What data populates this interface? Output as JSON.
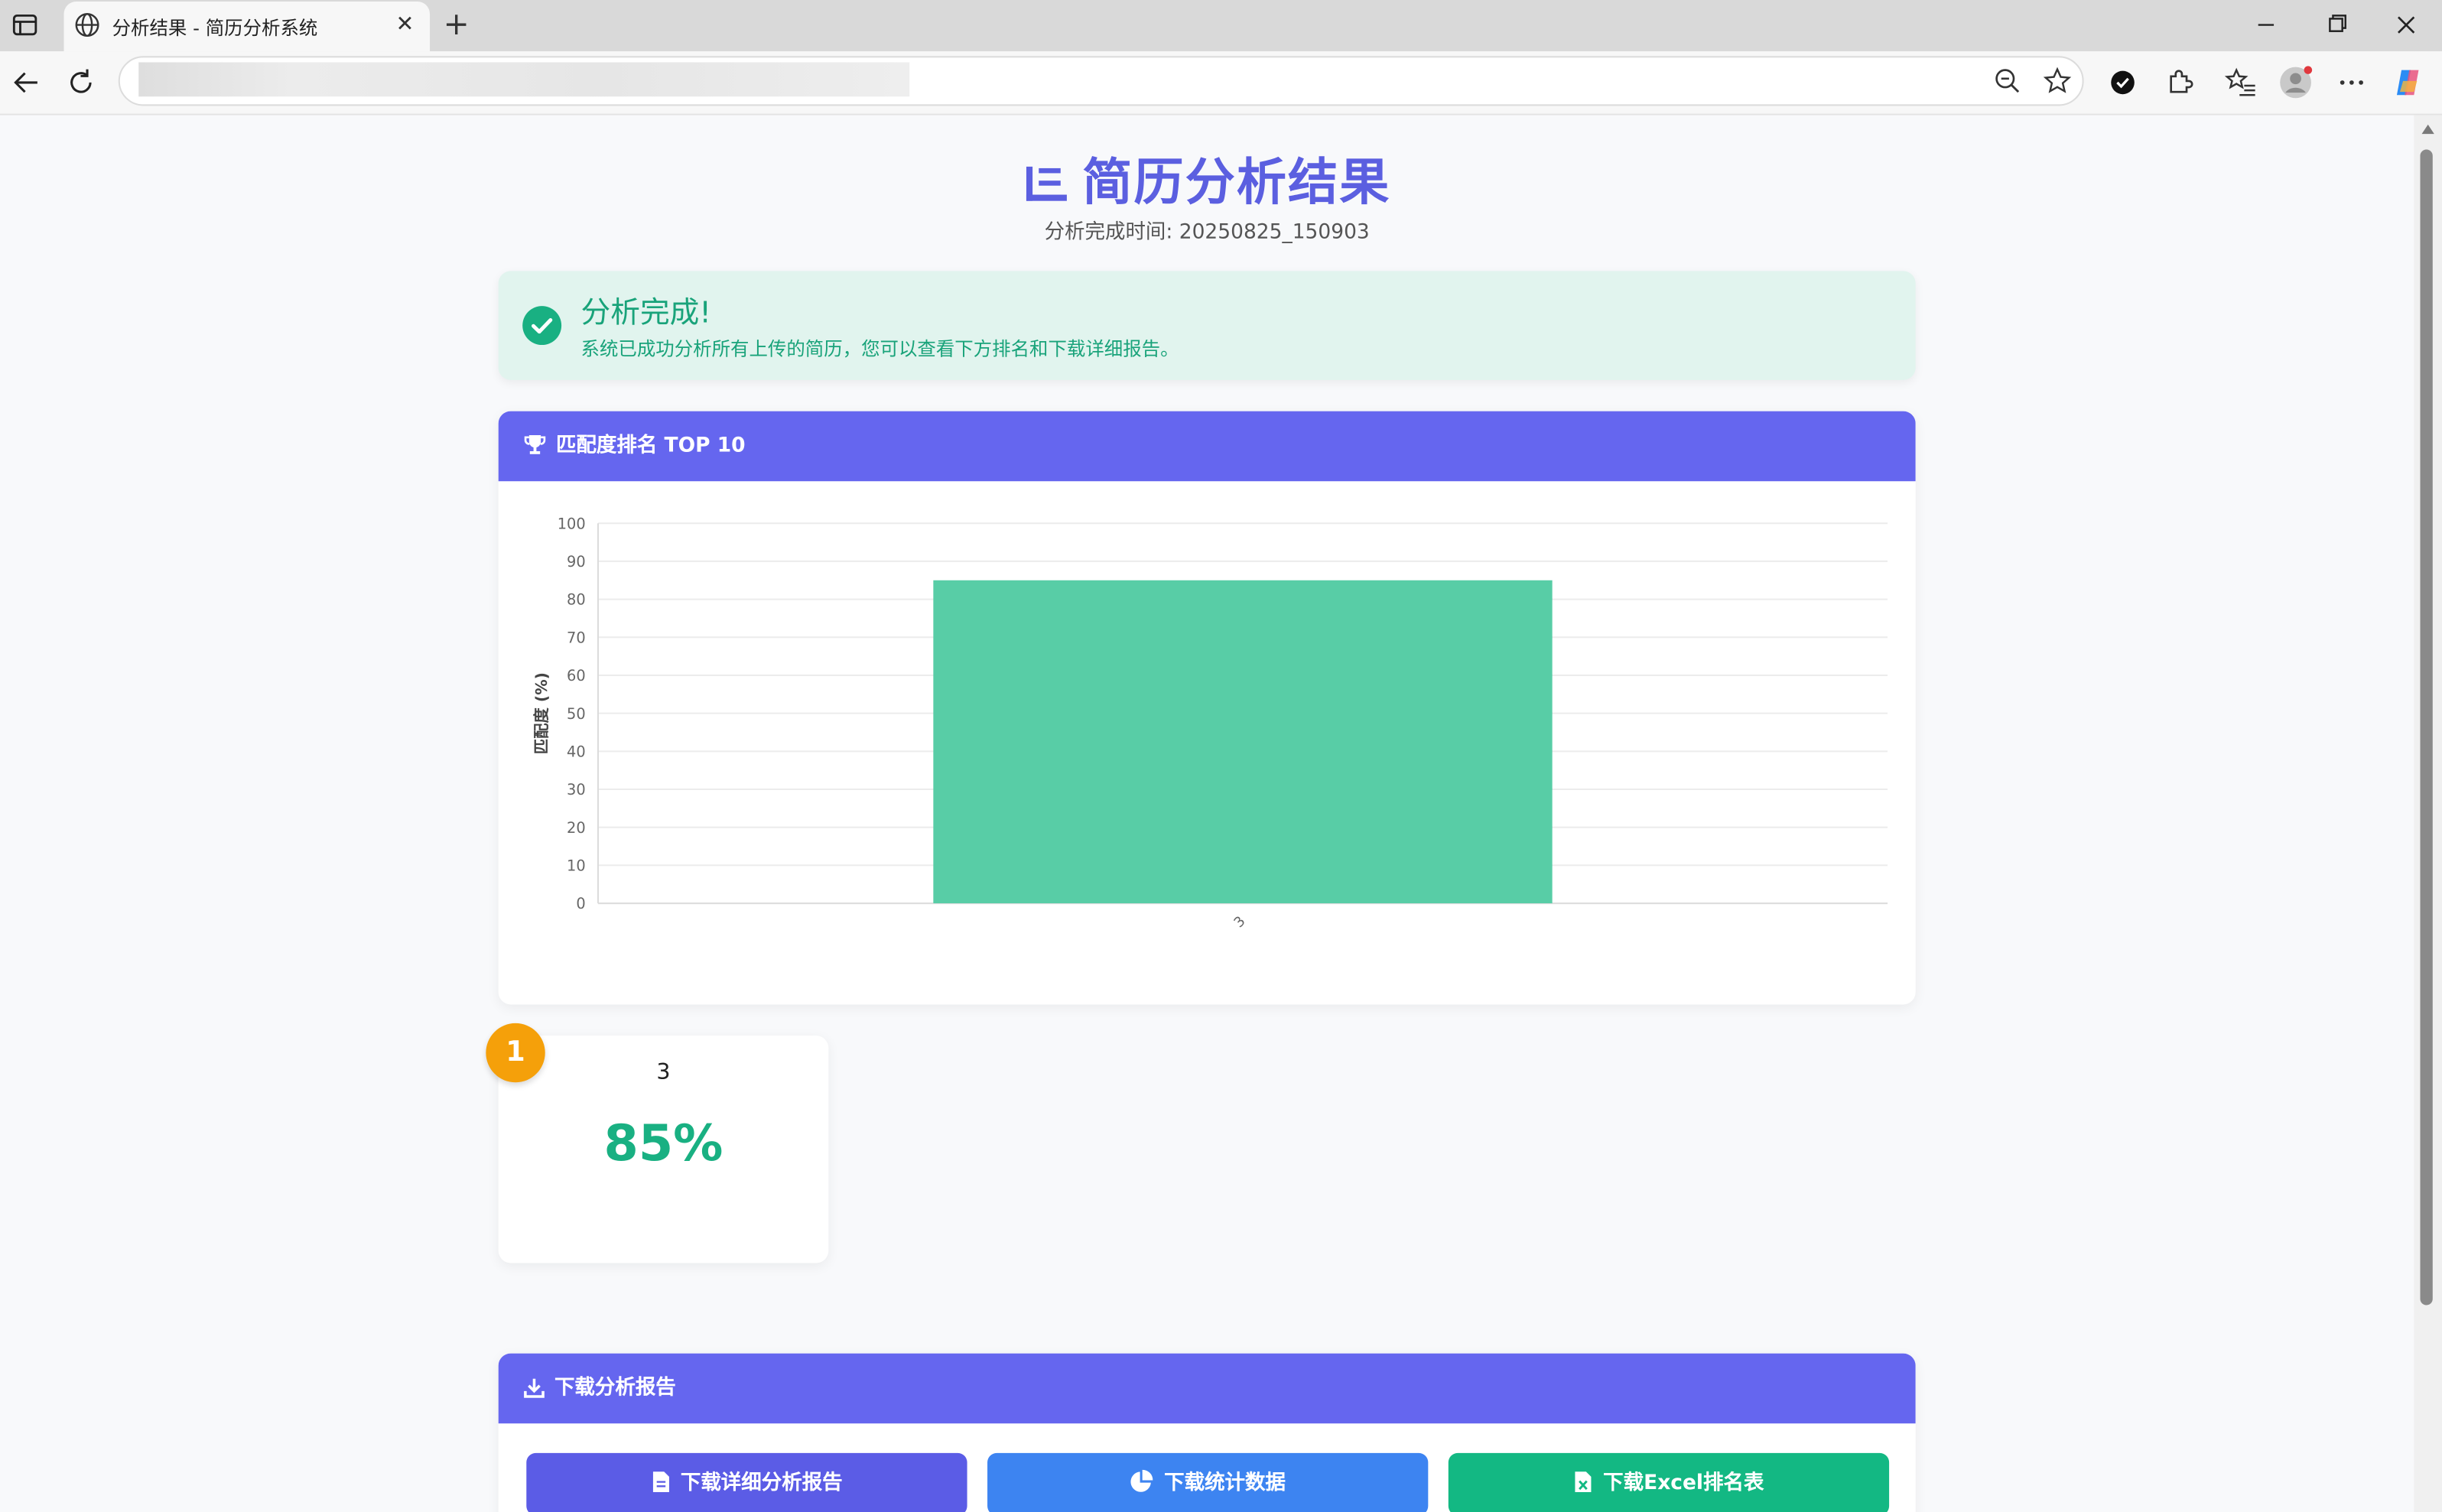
{
  "browser": {
    "tab_title": "分析结果 - 简历分析系统",
    "tab_close": "✕",
    "new_tab": "+",
    "url": ""
  },
  "header": {
    "title": "简历分析结果",
    "subtitle": "分析完成时间: 20250825_150903"
  },
  "alert": {
    "title": "分析完成!",
    "message": "系统已成功分析所有上传的简历，您可以查看下方排名和下载详细报告。"
  },
  "ranking_card": {
    "title": "匹配度排名 TOP 10"
  },
  "chart_data": {
    "type": "bar",
    "categories": [
      "3"
    ],
    "values": [
      85
    ],
    "ylabel": "匹配度 (%)",
    "xlabel": "",
    "ylim": [
      0,
      100
    ],
    "yticks": [
      0,
      10,
      20,
      30,
      40,
      50,
      60,
      70,
      80,
      90,
      100
    ],
    "grid": true,
    "bar_color": "#58cda6",
    "legend": "none"
  },
  "ranks": [
    {
      "rank": "1",
      "name": "3",
      "score": "85%"
    }
  ],
  "download": {
    "title": "下载分析报告",
    "buttons": [
      {
        "label": "下载详细分析报告",
        "color": "#5b5ce6",
        "icon": "file-icon"
      },
      {
        "label": "下载统计数据",
        "color": "#3d84f1",
        "icon": "pie-chart-icon"
      },
      {
        "label": "下载Excel排名表",
        "color": "#13b883",
        "icon": "excel-icon"
      }
    ]
  },
  "colors": {
    "accent": "#6566ef",
    "success": "#19a37a",
    "gold": "#f5a00a"
  }
}
